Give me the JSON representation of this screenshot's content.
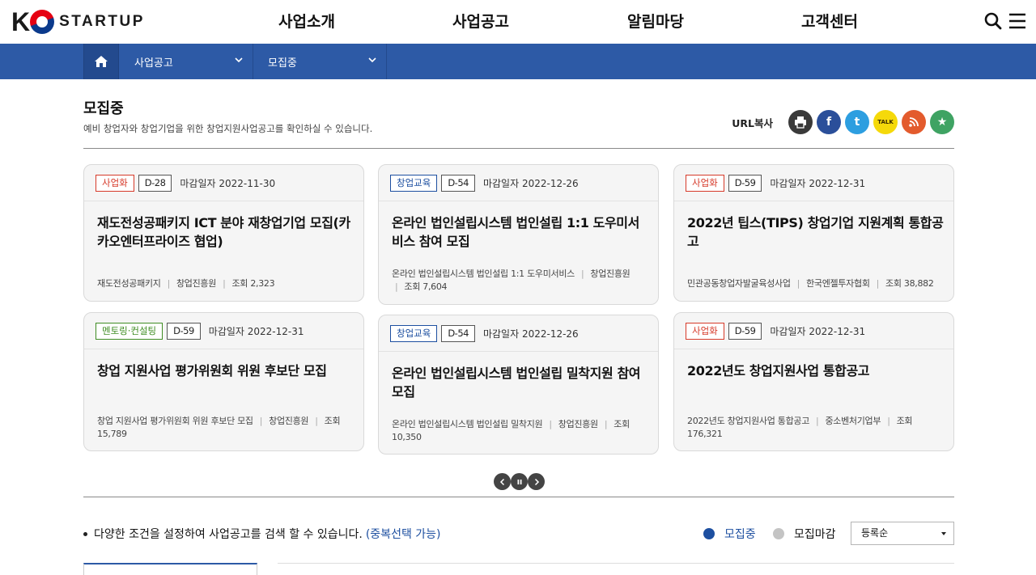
{
  "header": {
    "logo_k": "K",
    "logo_text": "STARTUP",
    "nav": [
      "사업소개",
      "사업공고",
      "알림마당",
      "고객센터"
    ]
  },
  "subnav": {
    "level1": "사업공고",
    "level2": "모집중"
  },
  "page": {
    "title": "모집중",
    "description": "예비 창업자와 창업기업을 위한 창업지원사업공고를 확인하실 수 있습니다.",
    "share_label": "URL복사"
  },
  "cards": [
    {
      "tag": "사업화",
      "tag_color": "red",
      "dday": "D-28",
      "deadline": "마감일자 2022-11-30",
      "title": "재도전성공패키지 ICT 분야 재창업기업 모집(카카오엔터프라이즈 협업)",
      "category": "재도전성공패키지",
      "org": "창업진흥원",
      "views": "조회 2,323"
    },
    {
      "tag": "창업교육",
      "tag_color": "blue",
      "dday": "D-54",
      "deadline": "마감일자 2022-12-26",
      "title": "온라인 법인설립시스템 법인설립 1:1 도우미서비스 참여 모집",
      "category": "온라인 법인설립시스템 법인설립 1:1 도우미서비스",
      "org": "창업진흥원",
      "views": "조회 7,604"
    },
    {
      "tag": "사업화",
      "tag_color": "red",
      "dday": "D-59",
      "deadline": "마감일자 2022-12-31",
      "title": "2022년 팁스(TIPS) 창업기업 지원계획 통합공고",
      "category": "민관공동창업자발굴육성사업",
      "org": "한국엔젤투자협회",
      "views": "조회 38,882"
    },
    {
      "tag": "멘토링·컨설팅",
      "tag_color": "green",
      "dday": "D-59",
      "deadline": "마감일자 2022-12-31",
      "title": "창업 지원사업 평가위원회 위원 후보단 모집",
      "category": "창업 지원사업 평가위원회 위원 후보단 모집",
      "org": "창업진흥원",
      "views_label": "조회",
      "views_num": "15,789"
    },
    {
      "tag": "창업교육",
      "tag_color": "blue",
      "dday": "D-54",
      "deadline": "마감일자 2022-12-26",
      "title": "온라인 법인설립시스템 법인설립 밀착지원 참여 모집",
      "category": "온라인 법인설립시스템 법인설립 밀착지원",
      "org": "창업진흥원",
      "views_label": "조회",
      "views_num": "10,350"
    },
    {
      "tag": "사업화",
      "tag_color": "red",
      "dday": "D-59",
      "deadline": "마감일자 2022-12-31",
      "title": "2022년도 창업지원사업 통합공고",
      "category": "2022년도 창업지원사업 통합공고",
      "org": "중소벤처기업부",
      "views_label": "조회",
      "views_num": "176,321"
    }
  ],
  "search": {
    "condition_text": "다양한 조건을 설정하여 사업공고를 검색 할 수 있습니다.",
    "condition_hint": "(중복선택 가능)",
    "radio_open": "모집중",
    "radio_closed": "모집마감",
    "sort_selected": "등록순"
  },
  "colors": {
    "brand_blue": "#2d5aa6",
    "tag_red": "#d63a2a",
    "tag_blue": "#1d4fa0",
    "tag_green": "#3f8c23"
  },
  "icons": [
    "search-icon",
    "menu-icon",
    "home-icon",
    "chevron-down-icon",
    "print-icon",
    "facebook-icon",
    "twitter-icon",
    "kakaotalk-icon",
    "rss-icon",
    "star-icon",
    "prev-icon",
    "pause-icon",
    "next-icon"
  ]
}
